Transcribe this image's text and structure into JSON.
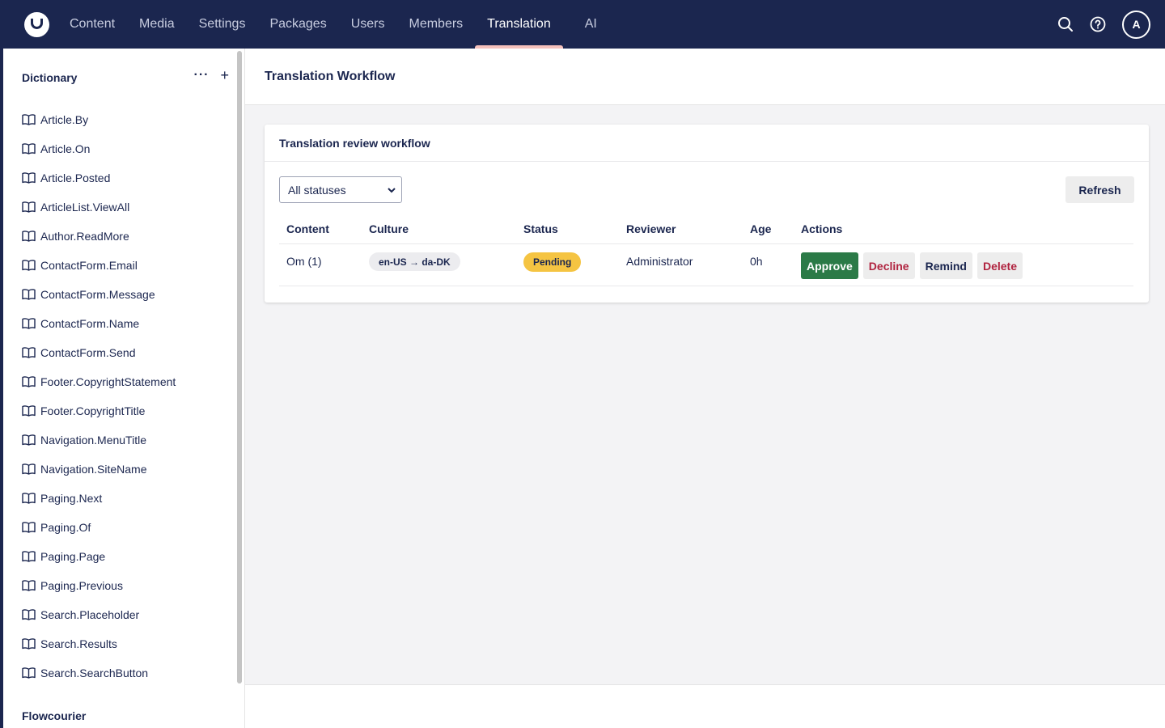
{
  "header": {
    "nav": [
      {
        "label": "Content"
      },
      {
        "label": "Media"
      },
      {
        "label": "Settings"
      },
      {
        "label": "Packages"
      },
      {
        "label": "Users"
      },
      {
        "label": "Members"
      },
      {
        "label": "Translation",
        "active": true
      },
      {
        "label": "AI"
      }
    ],
    "avatar_initial": "A",
    "icons": [
      "logo-icon",
      "search-icon",
      "help-icon"
    ]
  },
  "sidebar": {
    "title": "Dictionary",
    "items": [
      "Article.By",
      "Article.On",
      "Article.Posted",
      "ArticleList.ViewAll",
      "Author.ReadMore",
      "ContactForm.Email",
      "ContactForm.Message",
      "ContactForm.Name",
      "ContactForm.Send",
      "Footer.CopyrightStatement",
      "Footer.CopyrightTitle",
      "Navigation.MenuTitle",
      "Navigation.SiteName",
      "Paging.Next",
      "Paging.Of",
      "Paging.Page",
      "Paging.Previous",
      "Search.Placeholder",
      "Search.Results",
      "Search.SearchButton"
    ],
    "footer_section": "Flowcourier"
  },
  "main": {
    "title": "Translation Workflow",
    "card": {
      "title": "Translation review workflow",
      "filter_value": "All statuses",
      "refresh_label": "Refresh",
      "columns": [
        "Content",
        "Culture",
        "Status",
        "Reviewer",
        "Age",
        "Actions"
      ],
      "rows": [
        {
          "content": "Om (1)",
          "culture": "en-US → da-DK",
          "status": "Pending",
          "reviewer": "Administrator",
          "age": "0h",
          "actions": [
            "Approve",
            "Decline",
            "Remind",
            "Delete"
          ]
        }
      ]
    }
  },
  "colors": {
    "header_bg": "#1b264f",
    "active_tab_indicator": "#f5c1bc",
    "status_pending": "#f5c442",
    "approve": "#2b7a47",
    "danger_text": "#b0233f"
  }
}
